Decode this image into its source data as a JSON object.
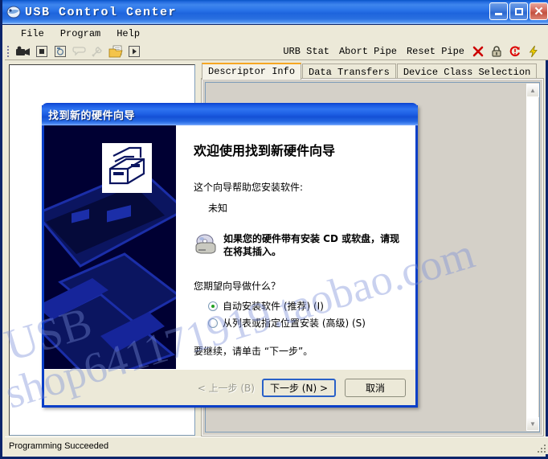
{
  "window": {
    "title": "USB Control Center",
    "icon": "usb-device-icon",
    "buttons": {
      "minimize": "minimize-icon",
      "maximize": "maximize-icon",
      "close": "close-icon"
    }
  },
  "menu": {
    "items": [
      {
        "label": "File"
      },
      {
        "label": "Program"
      },
      {
        "label": "Help"
      }
    ]
  },
  "toolbar": {
    "icons": [
      {
        "name": "device-camera-icon",
        "glyph": "▬▶",
        "enabled": true
      },
      {
        "name": "stop-icon",
        "glyph": "■",
        "enabled": true
      },
      {
        "name": "snapshot-icon",
        "glyph": "◎",
        "enabled": true
      },
      {
        "name": "comment-icon",
        "glyph": "○",
        "enabled": false
      },
      {
        "name": "wrench-icon",
        "glyph": "⚒",
        "enabled": false
      },
      {
        "name": "open-folder-icon",
        "glyph": "▰",
        "enabled": true
      },
      {
        "name": "play-icon",
        "glyph": "▶",
        "enabled": true
      }
    ],
    "commands": [
      {
        "label": "URB Stat"
      },
      {
        "label": "Abort Pipe"
      },
      {
        "label": "Reset Pipe"
      }
    ],
    "status_icons": [
      {
        "name": "cancel-x-icon",
        "glyph": "✖",
        "color": "#cc0000"
      },
      {
        "name": "lock-icon",
        "glyph": "⚿",
        "color": "#4a4a3a"
      },
      {
        "name": "reset-icon",
        "glyph": "↻",
        "color": "#dd0000"
      },
      {
        "name": "power-bolt-icon",
        "glyph": "⚡",
        "color": "#f2d000"
      }
    ]
  },
  "tabs": [
    {
      "label": "Descriptor Info",
      "active": true
    },
    {
      "label": "Data Transfers",
      "active": false
    },
    {
      "label": "Device Class Selection",
      "active": false
    }
  ],
  "status_bar": {
    "message": "Programming Succeeded"
  },
  "wizard": {
    "title": "找到新的硬件向导",
    "heading": "欢迎使用找到新硬件向导",
    "intro": "这个向导帮助您安装软件:",
    "device_name": "未知",
    "cd_note": "如果您的硬件带有安装 CD 或软盘，请现在将其插入。",
    "cd_icon": "cd-disk-icon",
    "question": "您期望向导做什么？",
    "options": [
      {
        "label": "自动安装软件 (推荐) (I)",
        "checked": true
      },
      {
        "label": "从列表或指定位置安装 (高级) (S)",
        "checked": false
      }
    ],
    "tail": "要继续，请单击 “下一步”。",
    "buttons": {
      "back": "< 上一步 (B)",
      "next": "下一步 (N) >",
      "cancel": "取消"
    }
  },
  "watermark": {
    "line1": "USB",
    "line2": "shop641171919.taobao.com"
  },
  "colors": {
    "title_bar_blue": "#2a6fe0",
    "dialog_blue": "#0a3fc8",
    "face": "#ece9d8",
    "banner_dark": "#000033",
    "tab_active_accent": "#f5a623",
    "radio_green": "#21a121"
  }
}
